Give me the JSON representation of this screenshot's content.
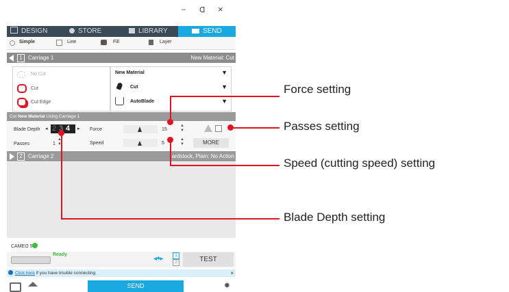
{
  "window": {
    "minimize": "–",
    "maximize": "ᗡ",
    "close": "×"
  },
  "nav": {
    "tabs": [
      {
        "label": "DESIGN"
      },
      {
        "label": "STORE"
      },
      {
        "label": "LIBRARY"
      },
      {
        "label": "SEND"
      }
    ]
  },
  "mode_tabs": [
    {
      "label": "Simple"
    },
    {
      "label": "Line"
    },
    {
      "label": "Fill"
    },
    {
      "label": "Layer"
    }
  ],
  "carriage1": {
    "num": "1",
    "label": "Carriage 1",
    "material": "New Material: Cut"
  },
  "line_styles": [
    {
      "label": "No Cut"
    },
    {
      "label": "Cut"
    },
    {
      "label": "Cut Edge"
    }
  ],
  "settings": {
    "material": "New Material",
    "action": "Cut",
    "tool": "AutoBlade"
  },
  "cut_banner": {
    "prefix": "Cut",
    "material": "New Material",
    "suffix": "Using Carriage 1"
  },
  "controls": {
    "blade_depth_label": "Blade Depth",
    "blade_depth_values": [
      "2",
      "3",
      "4"
    ],
    "blade_depth_selected": "4",
    "force_label": "Force",
    "force_value": "15",
    "passes_label": "Passes",
    "passes_value": "1",
    "speed_label": "Speed",
    "speed_value": "5",
    "more_label": "MORE"
  },
  "carriage2": {
    "num": "2",
    "label": "Carriage 2",
    "material": "ardstock, Plain: No Action"
  },
  "device": {
    "name": "CAMEO 5",
    "status": "Ready",
    "test_label": "TEST",
    "slot1": "1",
    "slot2": "2"
  },
  "help": {
    "link": "Click here",
    "text": "if you have trouble connecting.",
    "close": "×"
  },
  "send_label": "SEND",
  "callouts": {
    "force": "Force setting",
    "passes": "Passes setting",
    "speed": "Speed (cutting speed) setting",
    "blade_depth": "Blade Depth setting"
  },
  "colors": {
    "accent": "#1aa8e1",
    "nav": "#3b4a57",
    "callout": "#e11221",
    "ready": "#3cc03c"
  }
}
